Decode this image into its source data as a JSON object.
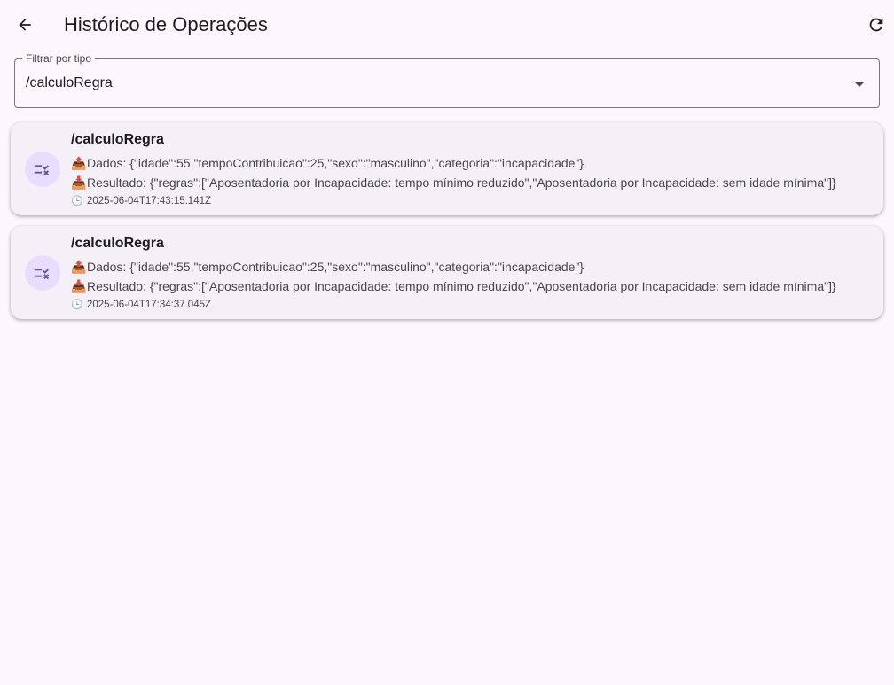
{
  "header": {
    "title": "Histórico de Operações",
    "back_icon": "arrow-left-icon",
    "refresh_icon": "refresh-icon"
  },
  "filter": {
    "label": "Filtrar por tipo",
    "selected": "/calculoRegra",
    "dropdown_icon": "caret-down-icon"
  },
  "colors": {
    "background": "#fdf7fd",
    "card": "#f5eff7",
    "avatar_bg": "#e9ddff",
    "accent": "#65558f"
  },
  "operations": [
    {
      "title": "/calculoRegra",
      "icon": "rule-check-icon",
      "dados_emoji": "📤",
      "dados": "Dados: {\"idade\":55,\"tempoContribuicao\":25,\"sexo\":\"masculino\",\"categoria\":\"incapacidade\"}",
      "resultado_emoji": "📥",
      "resultado": "Resultado: {\"regras\":[\"Aposentadoria por Incapacidade: tempo mínimo reduzido\",\"Aposentadoria por Incapacidade: sem idade mínima\"]}",
      "time_emoji": "🕒",
      "timestamp": "2025-06-04T17:43:15.141Z"
    },
    {
      "title": "/calculoRegra",
      "icon": "rule-check-icon",
      "dados_emoji": "📤",
      "dados": "Dados: {\"idade\":55,\"tempoContribuicao\":25,\"sexo\":\"masculino\",\"categoria\":\"incapacidade\"}",
      "resultado_emoji": "📥",
      "resultado": "Resultado: {\"regras\":[\"Aposentadoria por Incapacidade: tempo mínimo reduzido\",\"Aposentadoria por Incapacidade: sem idade mínima\"]}",
      "time_emoji": "🕒",
      "timestamp": "2025-06-04T17:34:37.045Z"
    }
  ]
}
